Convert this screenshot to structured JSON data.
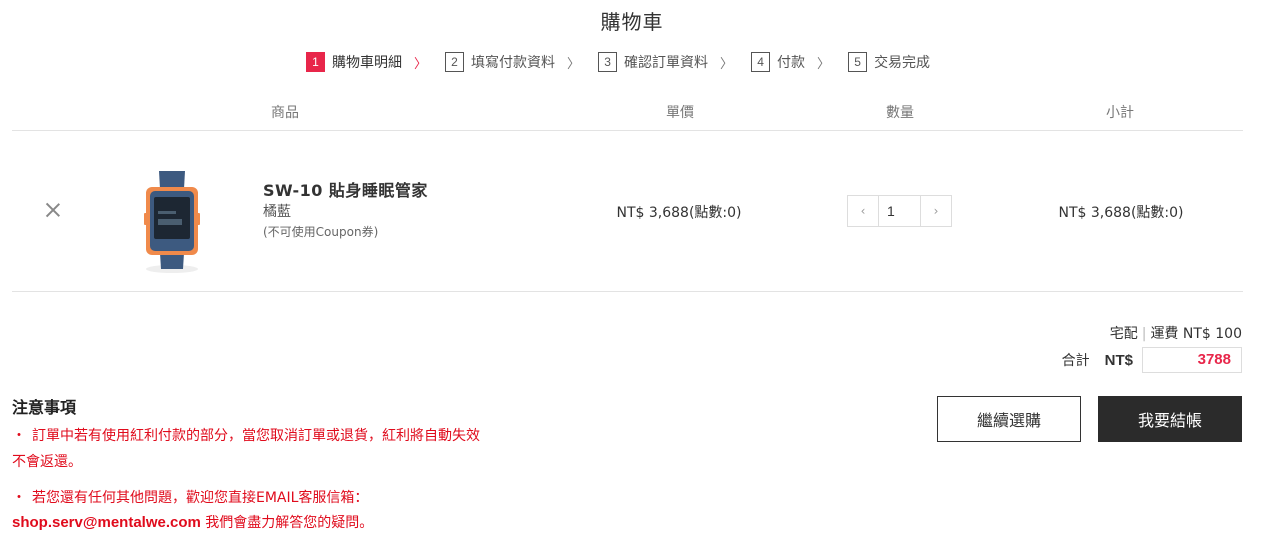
{
  "page_title": "購物車",
  "steps": [
    {
      "num": "1",
      "label": "購物車明細",
      "active": true
    },
    {
      "num": "2",
      "label": "填寫付款資料",
      "active": false
    },
    {
      "num": "3",
      "label": "確認訂單資料",
      "active": false
    },
    {
      "num": "4",
      "label": "付款",
      "active": false
    },
    {
      "num": "5",
      "label": "交易完成",
      "active": false
    }
  ],
  "step_separator": "〉",
  "table": {
    "headers": {
      "product": "商品",
      "unit_price": "單價",
      "quantity": "數量",
      "subtotal": "小計"
    }
  },
  "item": {
    "name": "SW-10 貼身睡眠管家",
    "variant": "橘藍",
    "note": "(不可使用Coupon券)",
    "unit_price": "NT$ 3,688(點數:0)",
    "quantity": "1",
    "subtotal": "NT$ 3,688(點數:0)",
    "image_icon": "smartwatch-product-image"
  },
  "summary": {
    "shipping_method": "宅配",
    "shipping_separator": "|",
    "shipping_fee": "運費 NT$ 100",
    "total_label": "合計",
    "total_currency": "NT$",
    "total_value": "3788"
  },
  "buttons": {
    "continue": "繼續選購",
    "checkout": "我要結帳"
  },
  "notes": {
    "title": "注意事項",
    "bullet": "・",
    "line1": "訂單中若有使用紅利付款的部分，當您取消訂單或退貨，紅利將自動失效",
    "line2": "不會返還。",
    "line3": "若您還有任何其他問題，歡迎您直接EMAIL客服信箱：",
    "email": "shop.serv@mentalwe.com",
    "line4_suffix": " 我們會盡力解答您的疑問。"
  },
  "colors": {
    "accent": "#e8264a",
    "notice_red": "#e00b1c",
    "checkout_bg": "#2b2b2b"
  }
}
